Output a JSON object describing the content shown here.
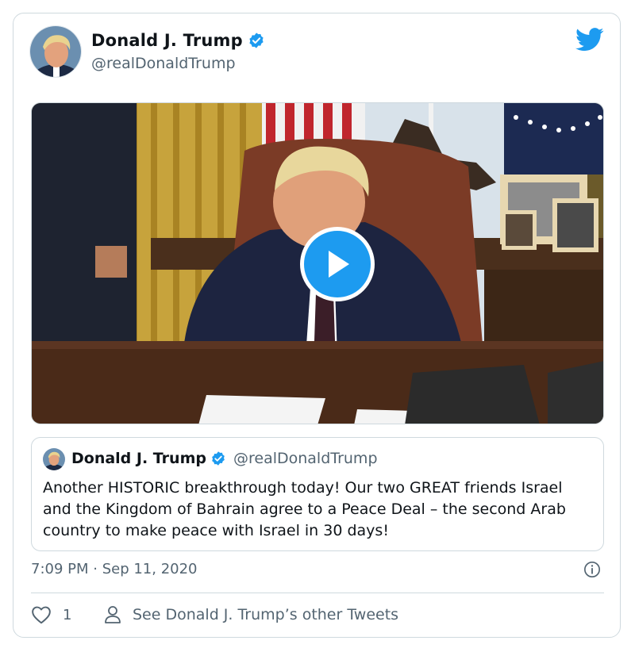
{
  "author": {
    "name": "Donald J. Trump",
    "handle": "@realDonaldTrump",
    "verified": true
  },
  "media": {
    "type": "video",
    "play_icon": "play-icon"
  },
  "quoted_tweet": {
    "name": "Donald J. Trump",
    "handle": "@realDonaldTrump",
    "verified": true,
    "text": "Another HISTORIC breakthrough today! Our two GREAT friends Israel and the Kingdom of Bahrain agree to a Peace Deal – the second Arab country to make peace with Israel in 30 days!"
  },
  "timestamp": "7:09 PM · Sep 11, 2020",
  "footer": {
    "like_count": "1",
    "like_icon": "heart-icon",
    "profile_icon": "person-icon",
    "other_tweets_label": "See Donald J. Trump’s other Tweets"
  },
  "colors": {
    "brand": "#1d9bf0",
    "text_secondary": "#536471",
    "border": "#cfd9de"
  }
}
